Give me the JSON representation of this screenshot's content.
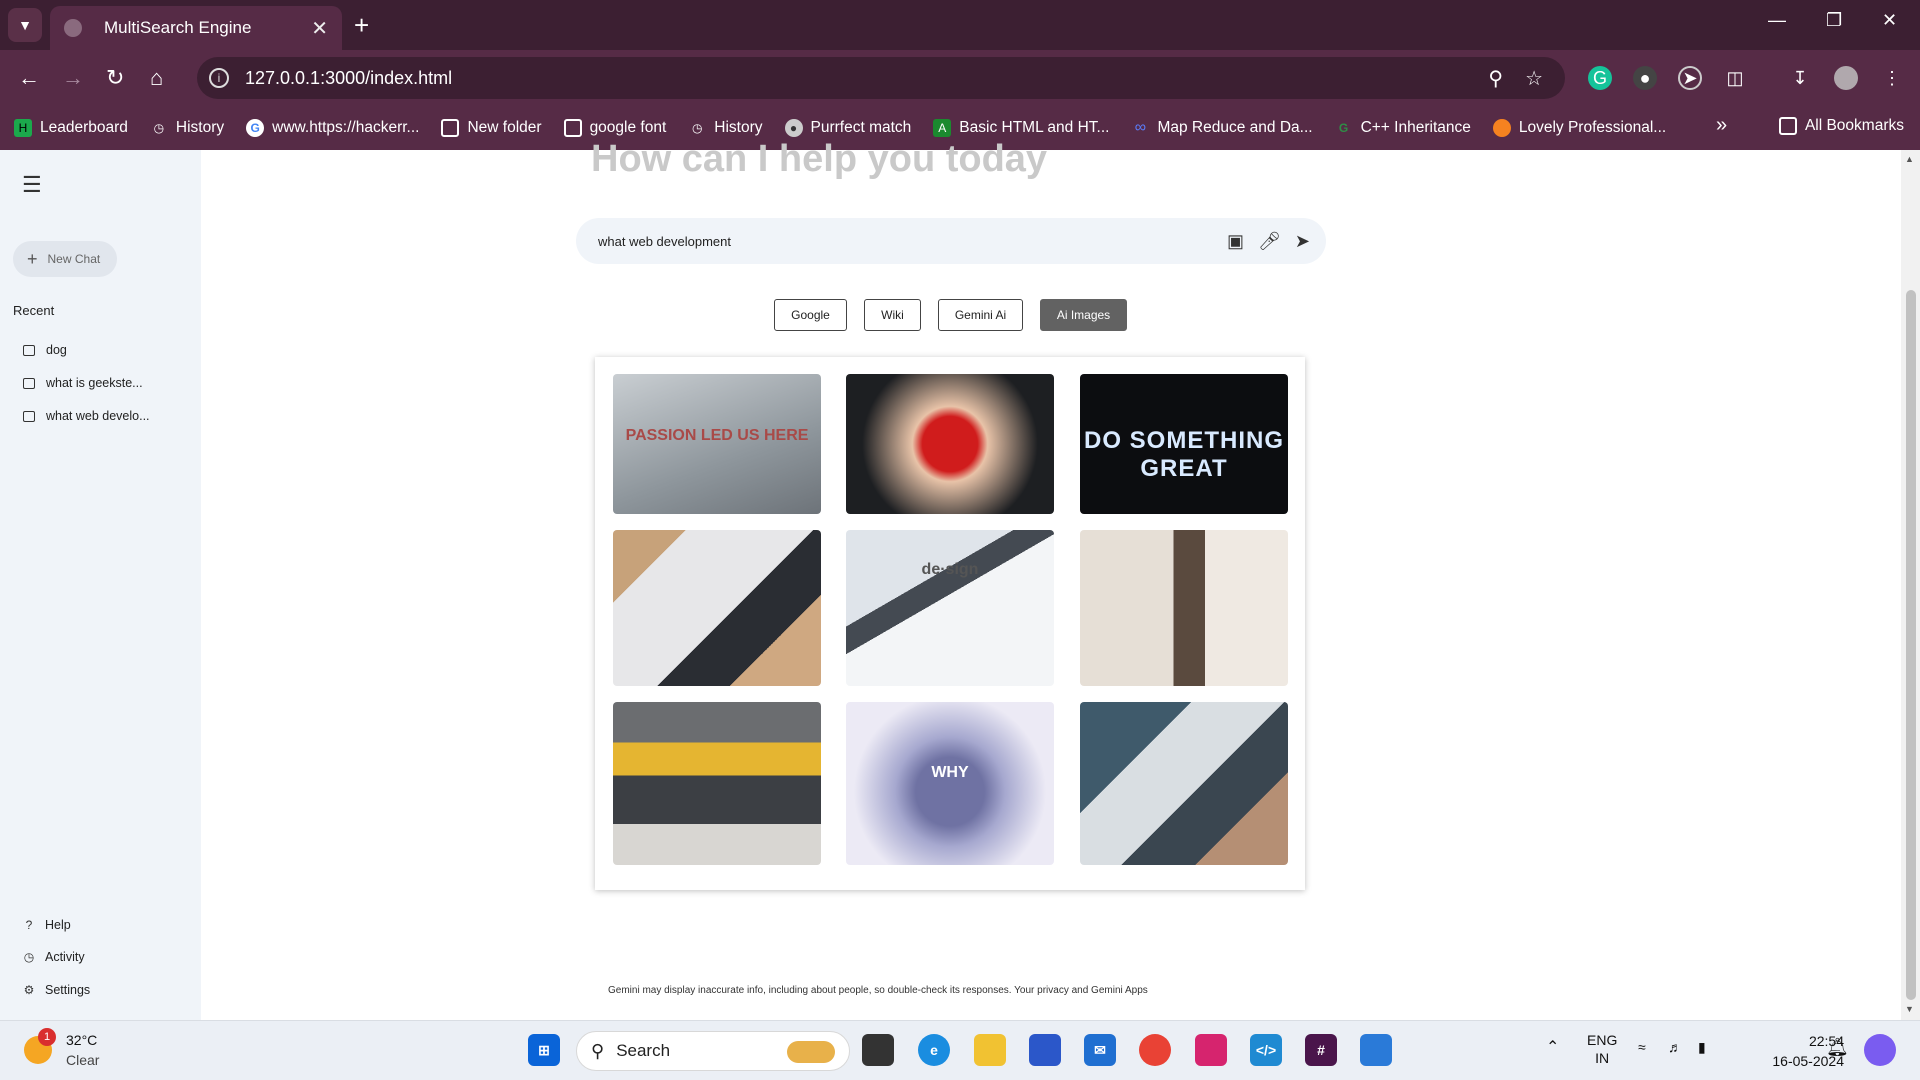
{
  "browser": {
    "tab_title": "MultiSearch Engine",
    "url": "127.0.0.1:3000/index.html",
    "bookmarks": [
      {
        "label": "Leaderboard",
        "icon": "hackerrank-icon",
        "color": "#1ba94c"
      },
      {
        "label": "History",
        "icon": "history-icon",
        "color": ""
      },
      {
        "label": "www.https://hackerr...",
        "icon": "google-icon",
        "color": "#ffffff"
      },
      {
        "label": "New folder",
        "icon": "folder-icon",
        "color": ""
      },
      {
        "label": "google font",
        "icon": "folder-icon",
        "color": ""
      },
      {
        "label": "History",
        "icon": "history-icon",
        "color": ""
      },
      {
        "label": "Purrfect match",
        "icon": "globe-icon",
        "color": ""
      },
      {
        "label": "Basic HTML and HT...",
        "icon": "codecademy-icon",
        "color": "#1b8a2f"
      },
      {
        "label": "Map Reduce and Da...",
        "icon": "infinity-icon",
        "color": "#5b7cfa"
      },
      {
        "label": "C++ Inheritance",
        "icon": "gfg-icon",
        "color": "#2f8d46"
      },
      {
        "label": "Lovely Professional...",
        "icon": "lpu-icon",
        "color": "#f58220"
      }
    ],
    "all_bookmarks_label": "All Bookmarks"
  },
  "sidebar": {
    "new_chat_label": "New Chat",
    "recent_heading": "Recent",
    "recent_items": [
      "dog",
      "what is geekste...",
      "what web develo..."
    ],
    "bottom_items": [
      "Help",
      "Activity",
      "Settings"
    ]
  },
  "main": {
    "heading": "How can I help you today",
    "search_value": "what web development",
    "engine_buttons": [
      "Google",
      "Wiki",
      "Gemini Ai",
      "Ai Images"
    ],
    "active_engine": "Ai Images",
    "images": [
      {
        "name": "passion-led-us-here-image",
        "caption": "PASSION LED US HERE",
        "bg": "linear-gradient(160deg,#c9ced2,#8e969c 60%,#6d7379)",
        "caption_color": "#a94a48"
      },
      {
        "name": "red-heart-hands-image",
        "caption": "",
        "bg": "radial-gradient(circle at 50% 50%,#d01c1c 0 22%,#e8c3a8 30%,#1d1f22 70%)",
        "caption_color": "#fff"
      },
      {
        "name": "do-something-great-neon-image",
        "caption": "DO SOMETHING GREAT",
        "bg": "#0c0d10",
        "caption_color": "#d9eaff"
      },
      {
        "name": "laptop-and-phone-image",
        "caption": "",
        "bg": "linear-gradient(135deg,#c7a27a 0 20%,#e7e7e9 20% 55%,#2a2d33 55% 75%,#cfa881 75%)",
        "caption_color": "#fff"
      },
      {
        "name": "design-definition-phone-image",
        "caption": "de·sign",
        "bg": "linear-gradient(150deg,#dfe4ea 0 35%,#444a52 35% 45%,#f3f5f7 45%)",
        "caption_color": "#555"
      },
      {
        "name": "two-women-laptop-image",
        "caption": "",
        "bg": "linear-gradient(90deg,#e6dfd6 0 45%,#5a4a3e 45% 60%,#efe9e2 60%)",
        "caption_color": "#fff"
      },
      {
        "name": "laptop-yellow-sofa-image",
        "caption": "",
        "bg": "linear-gradient(180deg,#6b6d70 0 25%,#e5b531 25% 45%,#3c3f44 45% 75%,#d8d6d2 75%)",
        "caption_color": "#fff"
      },
      {
        "name": "scattered-letters-why-image",
        "caption": "WHY",
        "bg": "radial-gradient(circle at 50% 55%,#6f72a3 0 25%,#a6a8cf 40%,#eceaf5 70%)",
        "caption_color": "#ffffff"
      },
      {
        "name": "typing-on-laptop-image",
        "caption": "",
        "bg": "linear-gradient(135deg,#3f5a6b 0 30%,#d9dee2 30% 55%,#3a4650 55% 75%,#b58f74 75%)",
        "caption_color": "#fff"
      }
    ],
    "disclaimer": "Gemini may display inaccurate info, including about people, so double-check its responses. Your privacy and Gemini Apps"
  },
  "taskbar": {
    "weather_badge": "1",
    "temperature": "32°C",
    "condition": "Clear",
    "search_placeholder": "Search",
    "lang_top": "ENG",
    "lang_bottom": "IN",
    "time": "22:54",
    "date": "16-05-2024"
  },
  "colors": {
    "chrome_dark": "#3c1f32",
    "chrome": "#562b46",
    "sidebar_bg": "#f0f4f9",
    "active_engine_bg": "#626262"
  }
}
